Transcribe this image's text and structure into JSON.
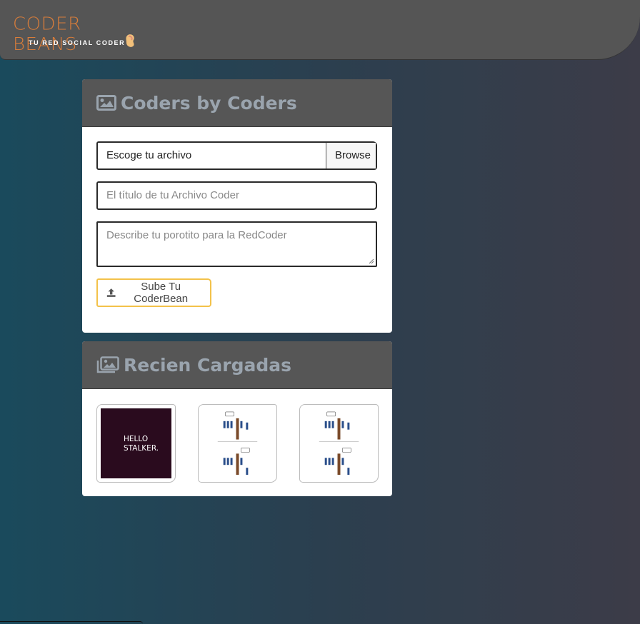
{
  "brand": {
    "name": "CODER BEANS",
    "tagline": "TU RED SOCIAL CODER",
    "accent": "#d97d3a"
  },
  "upload_panel": {
    "title": "Coders by Coders",
    "icon": "image-icon",
    "file_input": {
      "value": "Escoge tu archivo",
      "button_label": "Browse"
    },
    "title_input": {
      "placeholder": "El título de tu Archivo Coder"
    },
    "description_input": {
      "placeholder": "Describe tu porotito para la RedCoder"
    },
    "submit": {
      "label": "Sube Tu CoderBean",
      "icon": "upload-icon",
      "border_color": "#f3c24a"
    }
  },
  "recent_panel": {
    "title": "Recien Cargadas",
    "icon": "images-icon",
    "items": [
      {
        "kind": "text-image",
        "text_line1": "HELLO",
        "text_line2": "STALKER."
      },
      {
        "kind": "comic"
      },
      {
        "kind": "comic"
      }
    ]
  }
}
